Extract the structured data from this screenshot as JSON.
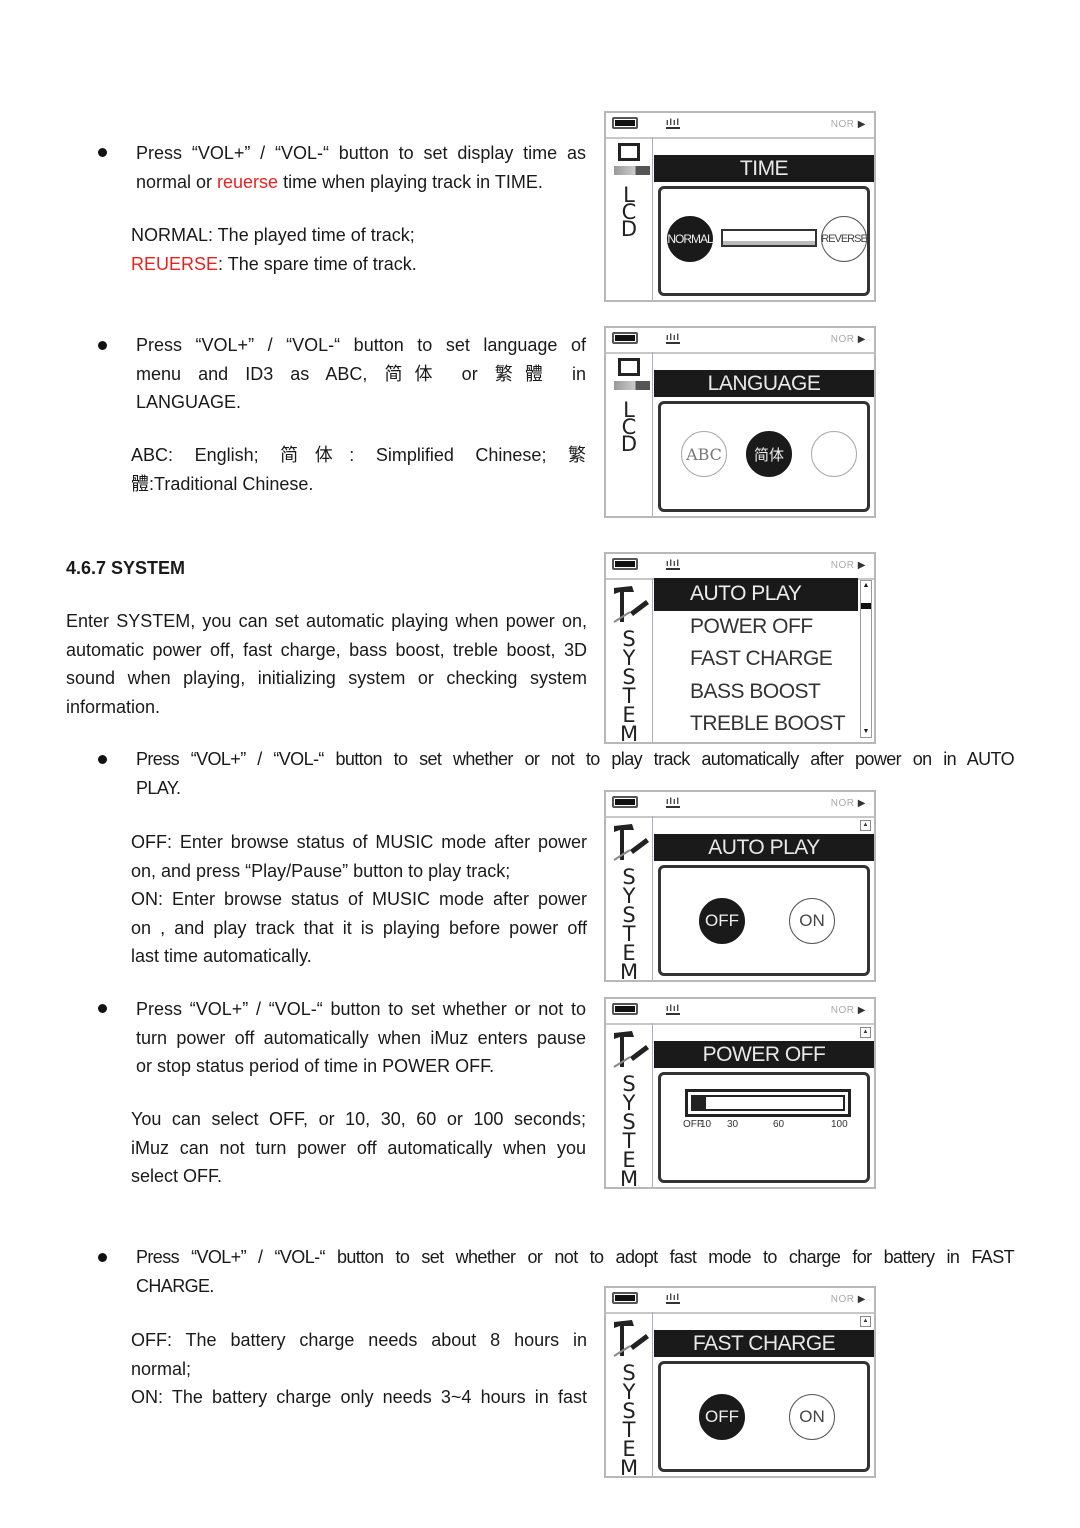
{
  "time_section": {
    "bullet_line1": "Press “VOL+” / “VOL-“ button to set display time as",
    "bullet_line2_pre": "normal or ",
    "bullet_line2_red": "reuerse",
    "bullet_line2_post": " time when playing track in TIME.",
    "normal_desc": "NORMAL: The played time of track;",
    "reverse_label": "REUERSE",
    "reverse_desc": ": The spare time of track.",
    "lcd": {
      "mode": "NOR",
      "side_label": [
        "L",
        "C",
        "D"
      ],
      "title": "TIME",
      "options": [
        "NORMAL",
        "REVERSE"
      ],
      "selected": "NORMAL"
    }
  },
  "language_section": {
    "bullet_line1": "Press “VOL+” / “VOL-“ button to set language of",
    "bullet_line2": "menu  and  ID3  as  ABC,  简 体   or  繁 體   in",
    "bullet_line3": "LANGUAGE.",
    "desc_line1": "ABC:  English;  简 体 :  Simplified  Chinese;  繁",
    "desc_line2": "體:Traditional Chinese.",
    "lcd": {
      "mode": "NOR",
      "side_label": [
        "L",
        "C",
        "D"
      ],
      "title": "LANGUAGE",
      "options": [
        "ABC",
        "简体",
        ""
      ],
      "selected": "简体"
    }
  },
  "system_section": {
    "heading": "4.6.7 SYSTEM",
    "intro_lines": [
      "Enter SYSTEM, you can set automatic playing when power on,",
      "automatic power off, fast charge, bass boost, treble boost, 3D",
      "sound when playing, initializing system or checking system",
      "information."
    ],
    "lcd": {
      "mode": "NOR",
      "side_label": [
        "S",
        "Y",
        "S",
        "T",
        "E",
        "M"
      ],
      "menu_items": [
        "AUTO PLAY",
        "POWER OFF",
        "FAST CHARGE",
        "BASS BOOST",
        "TREBLE BOOST"
      ],
      "selected": "AUTO PLAY"
    }
  },
  "auto_play_section": {
    "bullet_line1": "Press “VOL+” / “VOL-“ button to set whether or not to play track automatically after power on in AUTO",
    "bullet_line2": "PLAY.",
    "desc_lines": [
      "OFF: Enter browse status of MUSIC mode after power",
      "on, and press “Play/Pause” button to play track;",
      "ON: Enter browse status of MUSIC mode after power",
      "on , and play track that it is playing before power off",
      "last time automatically."
    ],
    "lcd": {
      "mode": "NOR",
      "side_label": [
        "S",
        "Y",
        "S",
        "T",
        "E",
        "M"
      ],
      "title": "AUTO PLAY",
      "options": [
        "OFF",
        "ON"
      ],
      "selected": "OFF"
    }
  },
  "power_off_section": {
    "bullet_lines": [
      "Press “VOL+” / “VOL-“ button to set whether or not to",
      "turn power off automatically when iMuz enters pause",
      "or stop status period of time in POWER OFF."
    ],
    "desc_lines": [
      "You  can  select  OFF,  or  10,  30,  60  or  100  seconds;",
      "iMuz  can  not  turn  power  off  automatically  when  you",
      "select OFF."
    ],
    "lcd": {
      "mode": "NOR",
      "side_label": [
        "S",
        "Y",
        "S",
        "T",
        "E",
        "M"
      ],
      "title": "POWER OFF",
      "scale_labels": [
        "OFF",
        "10",
        "30",
        "60",
        "100"
      ],
      "selected_value": "10",
      "fill_fraction": 0.1
    }
  },
  "fast_charge_section": {
    "bullet_line1": "Press “VOL+” / “VOL-“ button to set whether or not to adopt fast mode to charge for battery in FAST",
    "bullet_line2": "CHARGE.",
    "desc_lines": [
      "OFF:  The  battery  charge  needs  about  8  hours  in",
      "normal;",
      "ON: The battery charge only needs 3~4 hours in fast"
    ],
    "lcd": {
      "mode": "NOR",
      "side_label": [
        "S",
        "Y",
        "S",
        "T",
        "E",
        "M"
      ],
      "title": "FAST CHARGE",
      "options": [
        "OFF",
        "ON"
      ],
      "selected": "OFF"
    }
  }
}
